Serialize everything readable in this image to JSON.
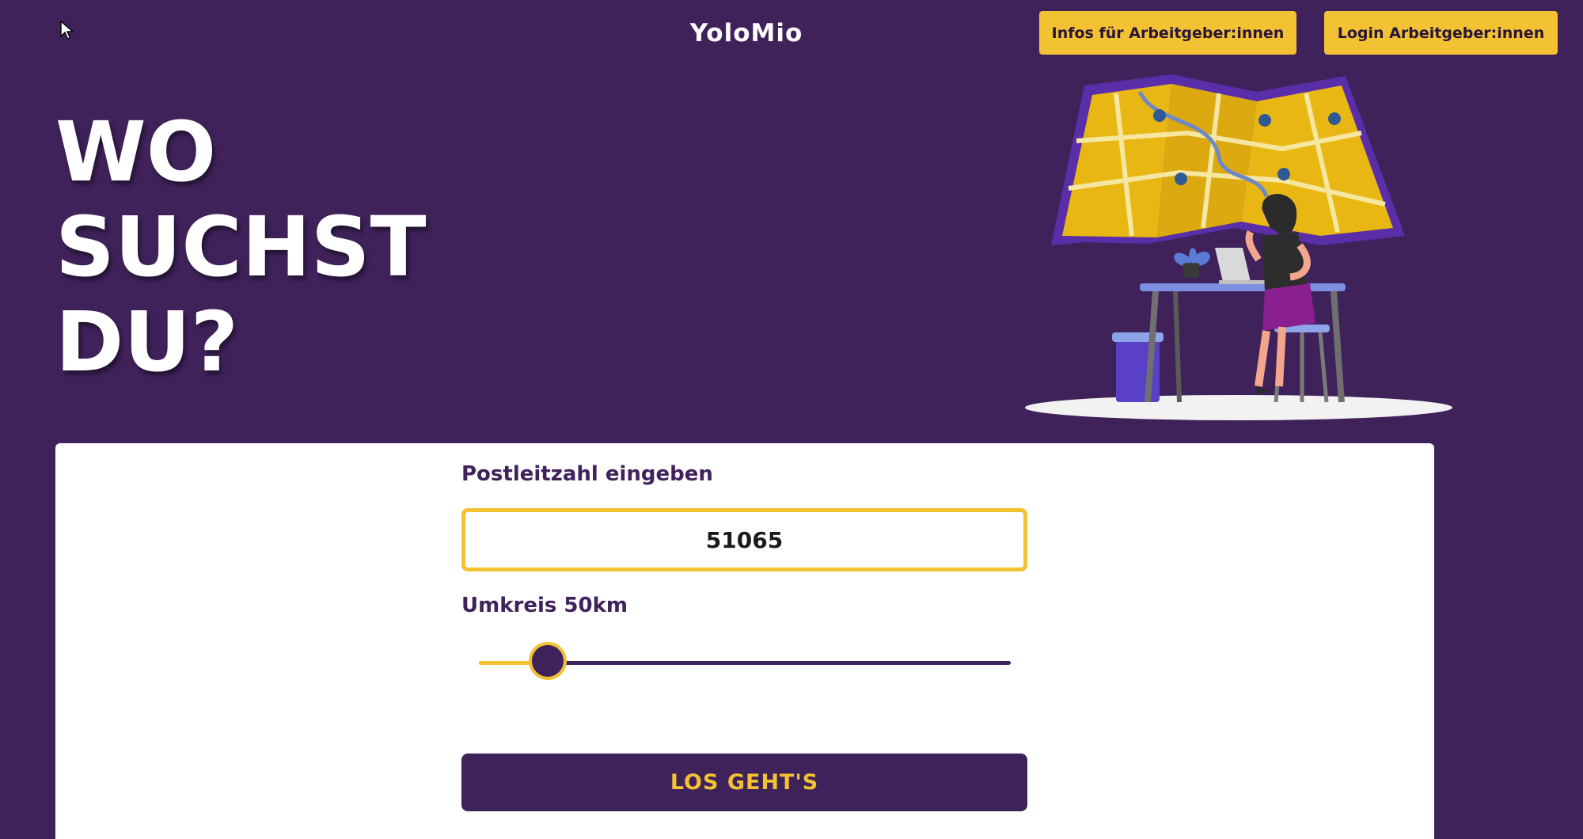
{
  "header": {
    "logo": "YoloMio",
    "infos_button": "Infos für Arbeitgeber:innen",
    "login_button": "Login Arbeitgeber:innen"
  },
  "hero": {
    "headline_lines": [
      "WO",
      "SUCHST",
      "DU?"
    ]
  },
  "search_form": {
    "plz_label": "Postleitzahl eingeben",
    "plz_value": "51065",
    "radius_label": "Umkreis 50km",
    "radius_slider_fraction": 0.13,
    "submit_label": "LOS GEHT'S"
  },
  "colors": {
    "background": "#40225b",
    "accent_yellow": "#f2c233",
    "card": "#ffffff"
  },
  "illustration": "woman-with-laptop-and-map-illustration"
}
